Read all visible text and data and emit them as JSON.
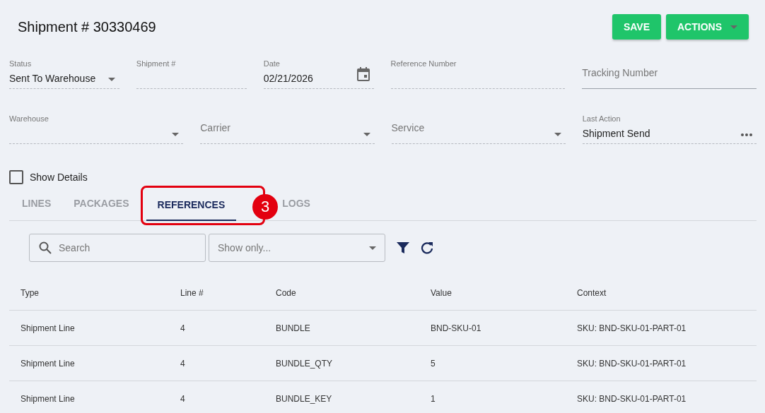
{
  "header": {
    "title": "Shipment # 30330469",
    "buttons": [
      {
        "label": "SAVE",
        "kind": "plain"
      },
      {
        "label": "ACTIONS",
        "kind": "menu"
      }
    ]
  },
  "fields_row_1": [
    {
      "label": "Status",
      "value": "Sent To Warehouse",
      "kind": "select"
    },
    {
      "label": "Shipment #",
      "kind": "text"
    },
    {
      "label": "Date",
      "value": "02/21/2026",
      "kind": "date"
    },
    {
      "label": "Reference Number",
      "kind": "text"
    },
    {
      "placeholder": "Tracking Number",
      "kind": "input"
    }
  ],
  "fields_row_2": [
    {
      "label": "Warehouse",
      "kind": "select"
    },
    {
      "placeholder": "Carrier",
      "kind": "select"
    },
    {
      "placeholder": "Service",
      "kind": "select"
    },
    {
      "label": "Last Action",
      "value": "Shipment Send",
      "kind": "more"
    }
  ],
  "show_details": {
    "label": "Show Details",
    "checked": false
  },
  "tabs": [
    {
      "label": "LINES",
      "selected": false
    },
    {
      "label": "PACKAGES",
      "selected": false
    },
    {
      "label": "REFERENCES",
      "selected": true
    },
    {
      "label": "LOGS",
      "selected": false
    }
  ],
  "annotation": {
    "badge": "3"
  },
  "toolbar": {
    "search": {
      "placeholder": "Search"
    },
    "filter": {
      "placeholder": "Show only..."
    }
  },
  "table": {
    "columns": [
      "Type",
      "Line #",
      "Code",
      "Value",
      "Context"
    ],
    "rows": [
      [
        "Shipment Line",
        "4",
        "BUNDLE",
        "BND-SKU-01",
        "SKU: BND-SKU-01-PART-01"
      ],
      [
        "Shipment Line",
        "4",
        "BUNDLE_QTY",
        "5",
        "SKU: BND-SKU-01-PART-01"
      ],
      [
        "Shipment Line",
        "4",
        "BUNDLE_KEY",
        "1",
        "SKU: BND-SKU-01-PART-01"
      ]
    ]
  }
}
